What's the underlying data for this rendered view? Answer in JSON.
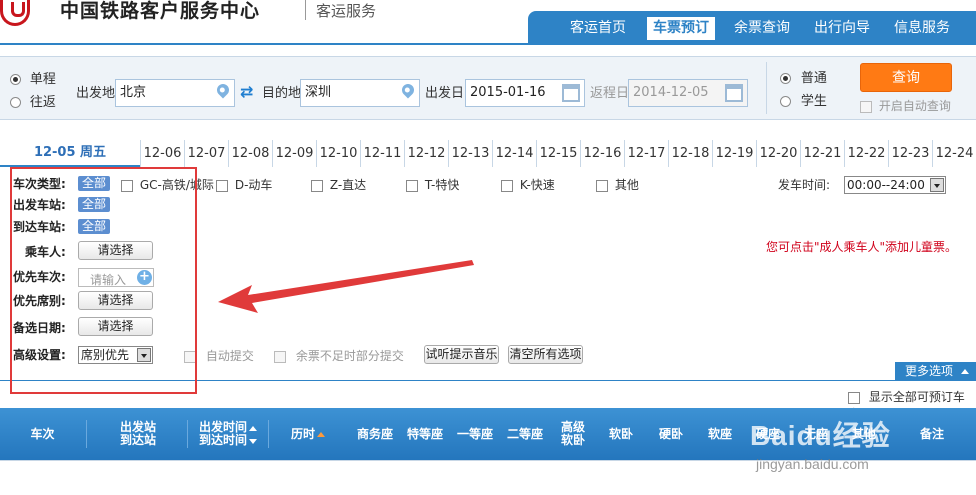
{
  "header": {
    "site_title": "中国铁路客户服务中心",
    "sub_title": "客运服务",
    "nav": [
      "客运首页",
      "车票预订",
      "余票查询",
      "出行向导",
      "信息服务"
    ],
    "nav_active_index": 1
  },
  "search": {
    "trip_types": [
      "单程",
      "往返"
    ],
    "from_label": "出发地",
    "from_value": "北京",
    "to_label": "目的地",
    "to_value": "深圳",
    "depart_label": "出发日",
    "depart_value": "2015-01-16",
    "return_label": "返程日",
    "return_value": "2014-12-05",
    "passenger_types": [
      "普通",
      "学生"
    ],
    "query_button": "查询",
    "auto_query_label": "开启自动查询"
  },
  "dates": {
    "first": "12-05 周五",
    "others": [
      "12-06",
      "12-07",
      "12-08",
      "12-09",
      "12-10",
      "12-11",
      "12-12",
      "12-13",
      "12-14",
      "12-15",
      "12-16",
      "12-17",
      "12-18",
      "12-19",
      "12-20",
      "12-21",
      "12-22",
      "12-23",
      "12-24"
    ]
  },
  "filters": {
    "train_type_label": "车次类型:",
    "all_tag": "全部",
    "train_types": [
      "GC-高铁/城际",
      "D-动车",
      "Z-直达",
      "T-特快",
      "K-快速",
      "其他"
    ],
    "depart_station_label": "出发车站:",
    "arrive_station_label": "到达车站:",
    "passenger_label": "乘车人:",
    "please_select": "请选择",
    "priority_train_label": "优先车次:",
    "priority_train_placeholder": "请输入",
    "priority_seat_label": "优先席别:",
    "alt_date_label": "备选日期:",
    "advanced_label": "高级设置:",
    "advanced_select": "席别优先",
    "auto_submit": "自动提交",
    "partial_submit": "余票不足时部分提交",
    "music_button": "试听提示音乐",
    "clear_button": "清空所有选项",
    "depart_time_label": "发车时间:",
    "depart_time_value": "00:00--24:00",
    "child_hint": "您可点击\"成人乘车人\"添加儿童票。",
    "more_options": "更多选项",
    "show_all_label": "显示全部可预订车次"
  },
  "table": {
    "columns": [
      {
        "l1": "车次"
      },
      {
        "l1": "出发站",
        "l2": "到达站"
      },
      {
        "l1": "出发时间",
        "l2": "到达时间"
      },
      {
        "l1": "历时"
      },
      {
        "l1": "商务座"
      },
      {
        "l1": "特等座"
      },
      {
        "l1": "一等座"
      },
      {
        "l1": "二等座"
      },
      {
        "l1": "高级",
        "l2": "软卧"
      },
      {
        "l1": "软卧"
      },
      {
        "l1": "硬卧"
      },
      {
        "l1": "软座"
      },
      {
        "l1": "硬座"
      },
      {
        "l1": "无座"
      },
      {
        "l1": "其他"
      },
      {
        "l1": "备注"
      }
    ]
  },
  "watermark": {
    "brand": "Baidu经验",
    "url": "jingyan.baidu.com"
  },
  "colors": {
    "brand_blue": "#2e83c6",
    "query_orange": "#ff7a14",
    "annotation_red": "#e03a3a"
  }
}
